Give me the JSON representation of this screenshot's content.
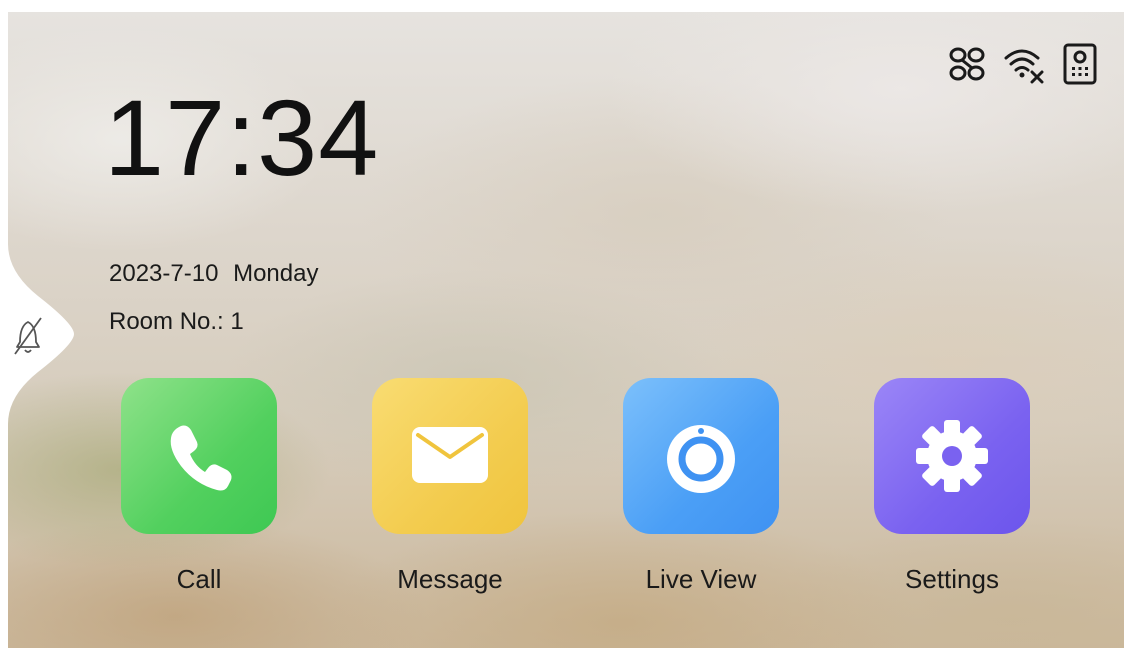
{
  "status_bar": {
    "icons": [
      "link-status-icon",
      "wifi-disconnected-icon",
      "door-station-icon"
    ]
  },
  "clock": {
    "time": "17:34"
  },
  "date": {
    "date": "2023-7-10",
    "weekday": "Monday"
  },
  "room": {
    "text": "Room No.: 1"
  },
  "side_tab": {
    "icon": "do-not-disturb-icon"
  },
  "apps": [
    {
      "label": "Call",
      "icon": "phone-icon",
      "color": "#4fd05c"
    },
    {
      "label": "Message",
      "icon": "envelope-icon",
      "color": "#f3cc4f"
    },
    {
      "label": "Live View",
      "icon": "camera-icon",
      "color": "#4b9ff6"
    },
    {
      "label": "Settings",
      "icon": "gear-icon",
      "color": "#7a62f0"
    }
  ]
}
